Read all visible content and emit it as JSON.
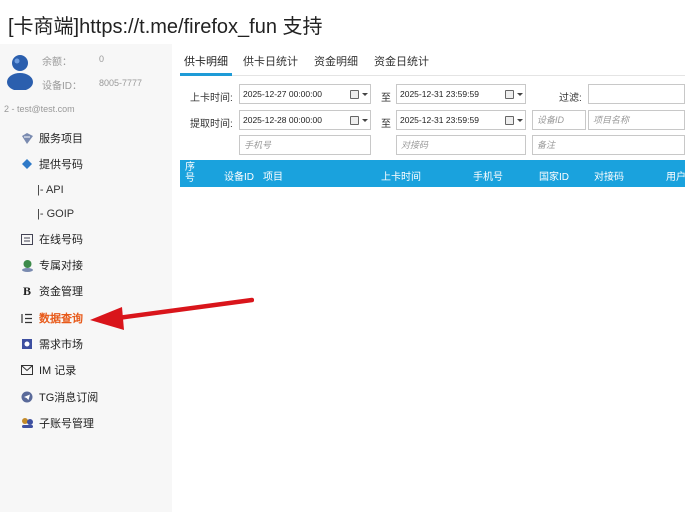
{
  "header": {
    "title": "[卡商端]https://t.me/firefox_fun 支持"
  },
  "account": {
    "balance_label": "余额：",
    "balance_value": "0",
    "device_label": "设备ID：",
    "device_value": "8005-7777",
    "user_line": "2 - test@test.com"
  },
  "sidebar": {
    "items": [
      {
        "label": "服务项目",
        "icon": "service-icon"
      },
      {
        "label": "提供号码",
        "icon": "provide-icon"
      },
      {
        "label": "|-  API",
        "icon": ""
      },
      {
        "label": "|-  GOIP",
        "icon": ""
      },
      {
        "label": "在线号码",
        "icon": "online-number-icon"
      },
      {
        "label": "专属对接",
        "icon": "exclusive-icon"
      },
      {
        "label": "资金管理",
        "icon": "bold-b-icon"
      },
      {
        "label": "数据查询",
        "icon": "list-icon"
      },
      {
        "label": "需求市场",
        "icon": "market-icon"
      },
      {
        "label": "IM 记录",
        "icon": "mail-icon"
      },
      {
        "label": "TG消息订阅",
        "icon": "telegram-icon"
      },
      {
        "label": "子账号管理",
        "icon": "users-icon"
      }
    ]
  },
  "tabs": [
    {
      "label": "供卡明细"
    },
    {
      "label": "供卡日统计"
    },
    {
      "label": "资金明细"
    },
    {
      "label": "资金日统计"
    }
  ],
  "filters": {
    "upload_time_label": "上卡时间:",
    "upload_start": "2025-12-27 00:00:00",
    "to_label_1": "至",
    "upload_end": "2025-12-31 23:59:59",
    "filter_label": "过滤:",
    "filter_value": "",
    "fetch_time_label": "提取时间:",
    "fetch_start": "2025-12-28 00:00:00",
    "to_label_2": "至",
    "fetch_end": "2025-12-31 23:59:59",
    "device_id_placeholder": "设备ID",
    "project_name_placeholder": "项目名称",
    "phone_placeholder": "手机号",
    "code_placeholder": "对接码",
    "remark_placeholder": "备注"
  },
  "table": {
    "columns": [
      "序号",
      "设备ID",
      "项目",
      "上卡时间",
      "手机号",
      "国家ID",
      "对接码",
      "用户"
    ]
  },
  "colors": {
    "accent": "#1aa2dd",
    "active_menu": "#e85a1a",
    "annotation_arrow": "#d9151b"
  }
}
